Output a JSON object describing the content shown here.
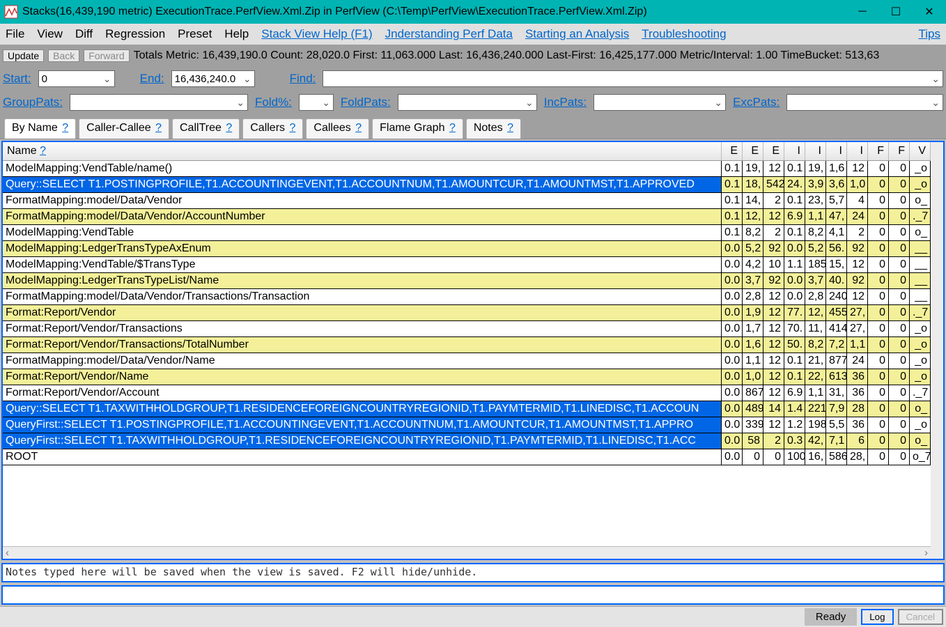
{
  "window": {
    "title": "Stacks(16,439,190 metric) ExecutionTrace.PerfView.Xml.Zip in PerfView (C:\\Temp\\PerfView\\ExecutionTrace.PerfView.Xml.Zip)"
  },
  "menu": {
    "file": "File",
    "view": "View",
    "diff": "Diff",
    "regression": "Regression",
    "preset": "Preset",
    "help": "Help",
    "link1": "Stack View Help (F1)",
    "link2": "Jnderstanding Perf Data",
    "link3": "Starting an Analysis",
    "link4": "Troubleshooting",
    "link5": "Tips"
  },
  "toolbar": {
    "update": "Update",
    "back": "Back",
    "forward": "Forward",
    "totals": "Totals Metric: 16,439,190.0  Count: 28,020.0  First: 11,063.000 Last: 16,436,240.000  Last-First: 16,425,177.000  Metric/Interval: 1.00  TimeBucket: 513,63"
  },
  "range": {
    "startLabel": "Start:",
    "startValue": "0",
    "endLabel": "End:",
    "endValue": "16,436,240.0",
    "findLabel": "Find:"
  },
  "filters": {
    "groupPats": "GroupPats:",
    "foldPct": "Fold%:",
    "foldPats": "FoldPats:",
    "incPats": "IncPats:",
    "excPats": "ExcPats:"
  },
  "tabs": {
    "byName": "By Name",
    "callerCallee": "Caller-Callee",
    "callTree": "CallTree",
    "callers": "Callers",
    "callees": "Callees",
    "flameGraph": "Flame Graph",
    "notes": "Notes",
    "q": "?"
  },
  "columns": {
    "name": "Name",
    "q": "?",
    "shortCols": [
      "E",
      "E",
      "E",
      "I",
      "I",
      "I",
      "I",
      "F",
      "F",
      "V"
    ]
  },
  "rows": [
    {
      "name": "ModelMapping:VendTable/name()",
      "c": [
        "0.1",
        "19,",
        "12",
        "0.1",
        "19,",
        "1,6",
        "12",
        "0",
        "0",
        "_o"
      ],
      "alt": false,
      "sel": false
    },
    {
      "name": "Query::SELECT T1.POSTINGPROFILE,T1.ACCOUNTINGEVENT,T1.ACCOUNTNUM,T1.AMOUNTCUR,T1.AMOUNTMST,T1.APPROVED",
      "c": [
        "0.1",
        "18,",
        "542",
        "24.",
        "3,9",
        "3,6",
        "1,0",
        "0",
        "0",
        "_o"
      ],
      "alt": true,
      "sel": true
    },
    {
      "name": "FormatMapping:model/Data/Vendor",
      "c": [
        "0.1",
        "14,",
        "2",
        "0.1",
        "23,",
        "5,7",
        "4",
        "0",
        "0",
        "o_"
      ],
      "alt": false,
      "sel": false
    },
    {
      "name": "FormatMapping:model/Data/Vendor/AccountNumber",
      "c": [
        "0.1",
        "12,",
        "12",
        "6.9",
        "1,1",
        "47,",
        "24",
        "0",
        "0",
        "._7"
      ],
      "alt": true,
      "sel": false
    },
    {
      "name": "ModelMapping:VendTable",
      "c": [
        "0.1",
        "8,2",
        "2",
        "0.1",
        "8,2",
        "4,1",
        "2",
        "0",
        "0",
        "o_"
      ],
      "alt": false,
      "sel": false
    },
    {
      "name": "ModelMapping:LedgerTransTypeAxEnum",
      "c": [
        "0.0",
        "5,2",
        "92",
        "0.0",
        "5,2",
        "56.",
        "92",
        "0",
        "0",
        "__"
      ],
      "alt": true,
      "sel": false
    },
    {
      "name": "ModelMapping:VendTable/$TransType",
      "c": [
        "0.0",
        "4,2",
        "10",
        "1.1",
        "185",
        "15,",
        "12",
        "0",
        "0",
        "__"
      ],
      "alt": false,
      "sel": false
    },
    {
      "name": "ModelMapping:LedgerTransTypeList/Name",
      "c": [
        "0.0",
        "3,7",
        "92",
        "0.0",
        "3,7",
        "40.",
        "92",
        "0",
        "0",
        "__"
      ],
      "alt": true,
      "sel": false
    },
    {
      "name": "FormatMapping:model/Data/Vendor/Transactions/Transaction",
      "c": [
        "0.0",
        "2,8",
        "12",
        "0.0",
        "2,8",
        "240",
        "12",
        "0",
        "0",
        "__"
      ],
      "alt": false,
      "sel": false
    },
    {
      "name": "Format:Report/Vendor",
      "c": [
        "0.0",
        "1,9",
        "12",
        "77.",
        "12,",
        "455",
        "27,",
        "0",
        "0",
        "._7"
      ],
      "alt": true,
      "sel": false
    },
    {
      "name": "Format:Report/Vendor/Transactions",
      "c": [
        "0.0",
        "1,7",
        "12",
        "70.",
        "11,",
        "414",
        "27,",
        "0",
        "0",
        "_o"
      ],
      "alt": false,
      "sel": false
    },
    {
      "name": "Format:Report/Vendor/Transactions/TotalNumber",
      "c": [
        "0.0",
        "1,6",
        "12",
        "50.",
        "8,2",
        "7,2",
        "1,1",
        "0",
        "0",
        "_o"
      ],
      "alt": true,
      "sel": false
    },
    {
      "name": "FormatMapping:model/Data/Vendor/Name",
      "c": [
        "0.0",
        "1,1",
        "12",
        "0.1",
        "21,",
        "877",
        "24",
        "0",
        "0",
        "_o"
      ],
      "alt": false,
      "sel": false
    },
    {
      "name": "Format:Report/Vendor/Name",
      "c": [
        "0.0",
        "1,0",
        "12",
        "0.1",
        "22,",
        "613",
        "36",
        "0",
        "0",
        "_o"
      ],
      "alt": true,
      "sel": false
    },
    {
      "name": "Format:Report/Vendor/Account",
      "c": [
        "0.0",
        "867",
        "12",
        "6.9",
        "1,1",
        "31,",
        "36",
        "0",
        "0",
        "._7"
      ],
      "alt": false,
      "sel": false
    },
    {
      "name": "Query::SELECT T1.TAXWITHHOLDGROUP,T1.RESIDENCEFOREIGNCOUNTRYREGIONID,T1.PAYMTERMID,T1.LINEDISC,T1.ACCOUN",
      "c": [
        "0.0",
        "489",
        "14",
        "1.4",
        "221",
        "7,9",
        "28",
        "0",
        "0",
        "o_"
      ],
      "alt": true,
      "sel": true
    },
    {
      "name": "QueryFirst::SELECT T1.POSTINGPROFILE,T1.ACCOUNTINGEVENT,T1.ACCOUNTNUM,T1.AMOUNTCUR,T1.AMOUNTMST,T1.APPRO",
      "c": [
        "0.0",
        "339",
        "12",
        "1.2",
        "198",
        "5,5",
        "36",
        "0",
        "0",
        "_o"
      ],
      "alt": false,
      "sel": true
    },
    {
      "name": "QueryFirst::SELECT T1.TAXWITHHOLDGROUP,T1.RESIDENCEFOREIGNCOUNTRYREGIONID,T1.PAYMTERMID,T1.LINEDISC,T1.ACC",
      "c": [
        "0.0",
        "58",
        "2",
        "0.3",
        "42,",
        "7,1",
        "6",
        "0",
        "0",
        "o_"
      ],
      "alt": true,
      "sel": true
    },
    {
      "name": "ROOT",
      "c": [
        "0.0",
        "0",
        "0",
        "100",
        "16,",
        "586",
        "28,",
        "0",
        "0",
        "o_7"
      ],
      "alt": false,
      "sel": false
    }
  ],
  "notes": {
    "placeholder": "Notes typed here will be saved when the view is saved. F2 will hide/unhide."
  },
  "status": {
    "ready": "Ready",
    "log": "Log",
    "cancel": "Cancel"
  }
}
